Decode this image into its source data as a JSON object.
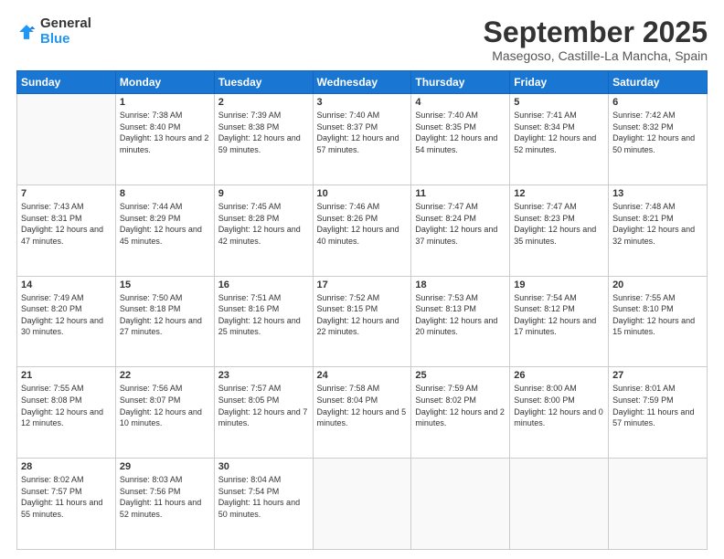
{
  "logo": {
    "general": "General",
    "blue": "Blue"
  },
  "header": {
    "month": "September 2025",
    "location": "Masegoso, Castille-La Mancha, Spain"
  },
  "weekdays": [
    "Sunday",
    "Monday",
    "Tuesday",
    "Wednesday",
    "Thursday",
    "Friday",
    "Saturday"
  ],
  "weeks": [
    [
      {
        "day": "",
        "sunrise": "",
        "sunset": "",
        "daylight": ""
      },
      {
        "day": "1",
        "sunrise": "Sunrise: 7:38 AM",
        "sunset": "Sunset: 8:40 PM",
        "daylight": "Daylight: 13 hours and 2 minutes."
      },
      {
        "day": "2",
        "sunrise": "Sunrise: 7:39 AM",
        "sunset": "Sunset: 8:38 PM",
        "daylight": "Daylight: 12 hours and 59 minutes."
      },
      {
        "day": "3",
        "sunrise": "Sunrise: 7:40 AM",
        "sunset": "Sunset: 8:37 PM",
        "daylight": "Daylight: 12 hours and 57 minutes."
      },
      {
        "day": "4",
        "sunrise": "Sunrise: 7:40 AM",
        "sunset": "Sunset: 8:35 PM",
        "daylight": "Daylight: 12 hours and 54 minutes."
      },
      {
        "day": "5",
        "sunrise": "Sunrise: 7:41 AM",
        "sunset": "Sunset: 8:34 PM",
        "daylight": "Daylight: 12 hours and 52 minutes."
      },
      {
        "day": "6",
        "sunrise": "Sunrise: 7:42 AM",
        "sunset": "Sunset: 8:32 PM",
        "daylight": "Daylight: 12 hours and 50 minutes."
      }
    ],
    [
      {
        "day": "7",
        "sunrise": "Sunrise: 7:43 AM",
        "sunset": "Sunset: 8:31 PM",
        "daylight": "Daylight: 12 hours and 47 minutes."
      },
      {
        "day": "8",
        "sunrise": "Sunrise: 7:44 AM",
        "sunset": "Sunset: 8:29 PM",
        "daylight": "Daylight: 12 hours and 45 minutes."
      },
      {
        "day": "9",
        "sunrise": "Sunrise: 7:45 AM",
        "sunset": "Sunset: 8:28 PM",
        "daylight": "Daylight: 12 hours and 42 minutes."
      },
      {
        "day": "10",
        "sunrise": "Sunrise: 7:46 AM",
        "sunset": "Sunset: 8:26 PM",
        "daylight": "Daylight: 12 hours and 40 minutes."
      },
      {
        "day": "11",
        "sunrise": "Sunrise: 7:47 AM",
        "sunset": "Sunset: 8:24 PM",
        "daylight": "Daylight: 12 hours and 37 minutes."
      },
      {
        "day": "12",
        "sunrise": "Sunrise: 7:47 AM",
        "sunset": "Sunset: 8:23 PM",
        "daylight": "Daylight: 12 hours and 35 minutes."
      },
      {
        "day": "13",
        "sunrise": "Sunrise: 7:48 AM",
        "sunset": "Sunset: 8:21 PM",
        "daylight": "Daylight: 12 hours and 32 minutes."
      }
    ],
    [
      {
        "day": "14",
        "sunrise": "Sunrise: 7:49 AM",
        "sunset": "Sunset: 8:20 PM",
        "daylight": "Daylight: 12 hours and 30 minutes."
      },
      {
        "day": "15",
        "sunrise": "Sunrise: 7:50 AM",
        "sunset": "Sunset: 8:18 PM",
        "daylight": "Daylight: 12 hours and 27 minutes."
      },
      {
        "day": "16",
        "sunrise": "Sunrise: 7:51 AM",
        "sunset": "Sunset: 8:16 PM",
        "daylight": "Daylight: 12 hours and 25 minutes."
      },
      {
        "day": "17",
        "sunrise": "Sunrise: 7:52 AM",
        "sunset": "Sunset: 8:15 PM",
        "daylight": "Daylight: 12 hours and 22 minutes."
      },
      {
        "day": "18",
        "sunrise": "Sunrise: 7:53 AM",
        "sunset": "Sunset: 8:13 PM",
        "daylight": "Daylight: 12 hours and 20 minutes."
      },
      {
        "day": "19",
        "sunrise": "Sunrise: 7:54 AM",
        "sunset": "Sunset: 8:12 PM",
        "daylight": "Daylight: 12 hours and 17 minutes."
      },
      {
        "day": "20",
        "sunrise": "Sunrise: 7:55 AM",
        "sunset": "Sunset: 8:10 PM",
        "daylight": "Daylight: 12 hours and 15 minutes."
      }
    ],
    [
      {
        "day": "21",
        "sunrise": "Sunrise: 7:55 AM",
        "sunset": "Sunset: 8:08 PM",
        "daylight": "Daylight: 12 hours and 12 minutes."
      },
      {
        "day": "22",
        "sunrise": "Sunrise: 7:56 AM",
        "sunset": "Sunset: 8:07 PM",
        "daylight": "Daylight: 12 hours and 10 minutes."
      },
      {
        "day": "23",
        "sunrise": "Sunrise: 7:57 AM",
        "sunset": "Sunset: 8:05 PM",
        "daylight": "Daylight: 12 hours and 7 minutes."
      },
      {
        "day": "24",
        "sunrise": "Sunrise: 7:58 AM",
        "sunset": "Sunset: 8:04 PM",
        "daylight": "Daylight: 12 hours and 5 minutes."
      },
      {
        "day": "25",
        "sunrise": "Sunrise: 7:59 AM",
        "sunset": "Sunset: 8:02 PM",
        "daylight": "Daylight: 12 hours and 2 minutes."
      },
      {
        "day": "26",
        "sunrise": "Sunrise: 8:00 AM",
        "sunset": "Sunset: 8:00 PM",
        "daylight": "Daylight: 12 hours and 0 minutes."
      },
      {
        "day": "27",
        "sunrise": "Sunrise: 8:01 AM",
        "sunset": "Sunset: 7:59 PM",
        "daylight": "Daylight: 11 hours and 57 minutes."
      }
    ],
    [
      {
        "day": "28",
        "sunrise": "Sunrise: 8:02 AM",
        "sunset": "Sunset: 7:57 PM",
        "daylight": "Daylight: 11 hours and 55 minutes."
      },
      {
        "day": "29",
        "sunrise": "Sunrise: 8:03 AM",
        "sunset": "Sunset: 7:56 PM",
        "daylight": "Daylight: 11 hours and 52 minutes."
      },
      {
        "day": "30",
        "sunrise": "Sunrise: 8:04 AM",
        "sunset": "Sunset: 7:54 PM",
        "daylight": "Daylight: 11 hours and 50 minutes."
      },
      {
        "day": "",
        "sunrise": "",
        "sunset": "",
        "daylight": ""
      },
      {
        "day": "",
        "sunrise": "",
        "sunset": "",
        "daylight": ""
      },
      {
        "day": "",
        "sunrise": "",
        "sunset": "",
        "daylight": ""
      },
      {
        "day": "",
        "sunrise": "",
        "sunset": "",
        "daylight": ""
      }
    ]
  ]
}
